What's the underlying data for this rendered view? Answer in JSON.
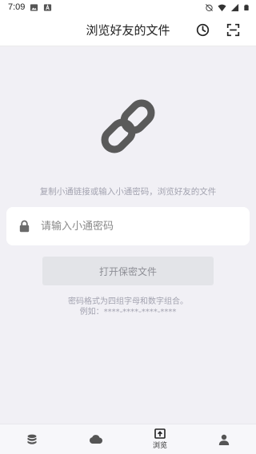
{
  "status_bar": {
    "time": "7:09",
    "left_icons": [
      "image-icon",
      "a-notification-icon"
    ],
    "right_icons": [
      "alarm-off-icon",
      "wifi-icon",
      "signal-icon",
      "battery-icon"
    ]
  },
  "app_bar": {
    "title": "浏览好友的文件",
    "actions": [
      {
        "name": "history-icon"
      },
      {
        "name": "scan-icon"
      }
    ]
  },
  "main": {
    "illustration": "link-icon",
    "hint": "复制小通链接或输入小通密码，浏览好友的文件",
    "password_field": {
      "placeholder": "请输入小通密码",
      "value": "",
      "icon": "lock-icon"
    },
    "open_button": "打开保密文件",
    "note_line1": "密码格式为四组字母和数字组合。",
    "note_line2": "例如：****-****-****-****"
  },
  "tab_bar": {
    "tabs": [
      {
        "icon": "database-icon",
        "label": "",
        "active": false
      },
      {
        "icon": "cloud-icon",
        "label": "",
        "active": false
      },
      {
        "icon": "browse-icon",
        "label": "浏览",
        "active": true
      },
      {
        "icon": "user-icon",
        "label": "",
        "active": false
      }
    ]
  },
  "colors": {
    "background": "#f1f0f5",
    "surface": "#ffffff",
    "button_disabled": "#e3e4e8",
    "muted_text": "#a3a3b0",
    "icon_dark": "#555555"
  }
}
